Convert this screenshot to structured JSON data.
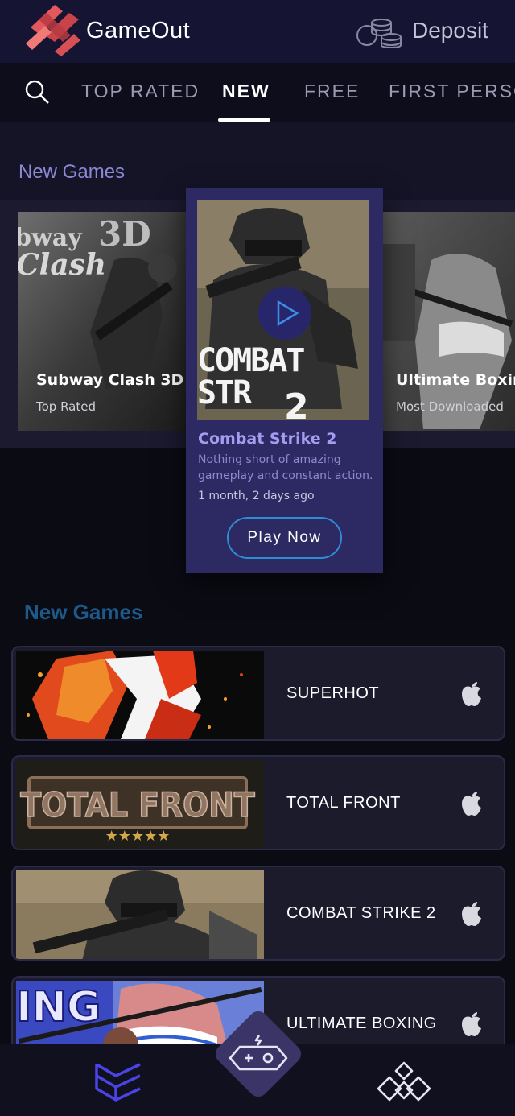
{
  "header": {
    "brand": "GameOut",
    "deposit_label": "Deposit",
    "logo_icon": "gameout-logo-icon",
    "coins_icon": "coins-icon"
  },
  "tabs": {
    "items": [
      "TOP RATED",
      "NEW",
      "FREE",
      "FIRST PERSO"
    ],
    "active": "NEW",
    "search_icon": "search-icon"
  },
  "featured": {
    "section_title": "New Games",
    "left_card": {
      "title": "Subway Clash 3D",
      "subtitle": "Top Rated",
      "art_text_1": "bway",
      "art_text_2": "3D",
      "art_text_3": "Clash"
    },
    "center_card": {
      "title": "Combat Strike 2",
      "art_title": "COMBAT STR",
      "art_number": "2",
      "description": "Nothing short of amazing gameplay and constant action.",
      "time": "1 month, 2 days ago",
      "play_label": "Play Now"
    },
    "right_card": {
      "title": "Ultimate Boxing",
      "subtitle": "Most Downloaded"
    }
  },
  "list": {
    "section_title": "New Games",
    "items": [
      {
        "label": "SUPERHOT",
        "platform_icon": "apple-icon"
      },
      {
        "label": "TOTAL FRONT",
        "platform_icon": "apple-icon",
        "art_text": "TOTAL FRONT"
      },
      {
        "label": "COMBAT STRIKE 2",
        "platform_icon": "apple-icon"
      },
      {
        "label": "ULTIMATE BOXING",
        "platform_icon": "apple-icon",
        "art_text": "ING"
      }
    ]
  },
  "bottom_nav": {
    "left_icon": "games-library-icon",
    "center_icon": "gamepad-icon",
    "right_icon": "diamond-cluster-icon"
  },
  "colors": {
    "header_bg": "#161433",
    "accent_purple": "#8b88d4",
    "card_purple": "#2d2963",
    "play_border": "#2d8ed6",
    "list_title": "#1c5a8c"
  }
}
